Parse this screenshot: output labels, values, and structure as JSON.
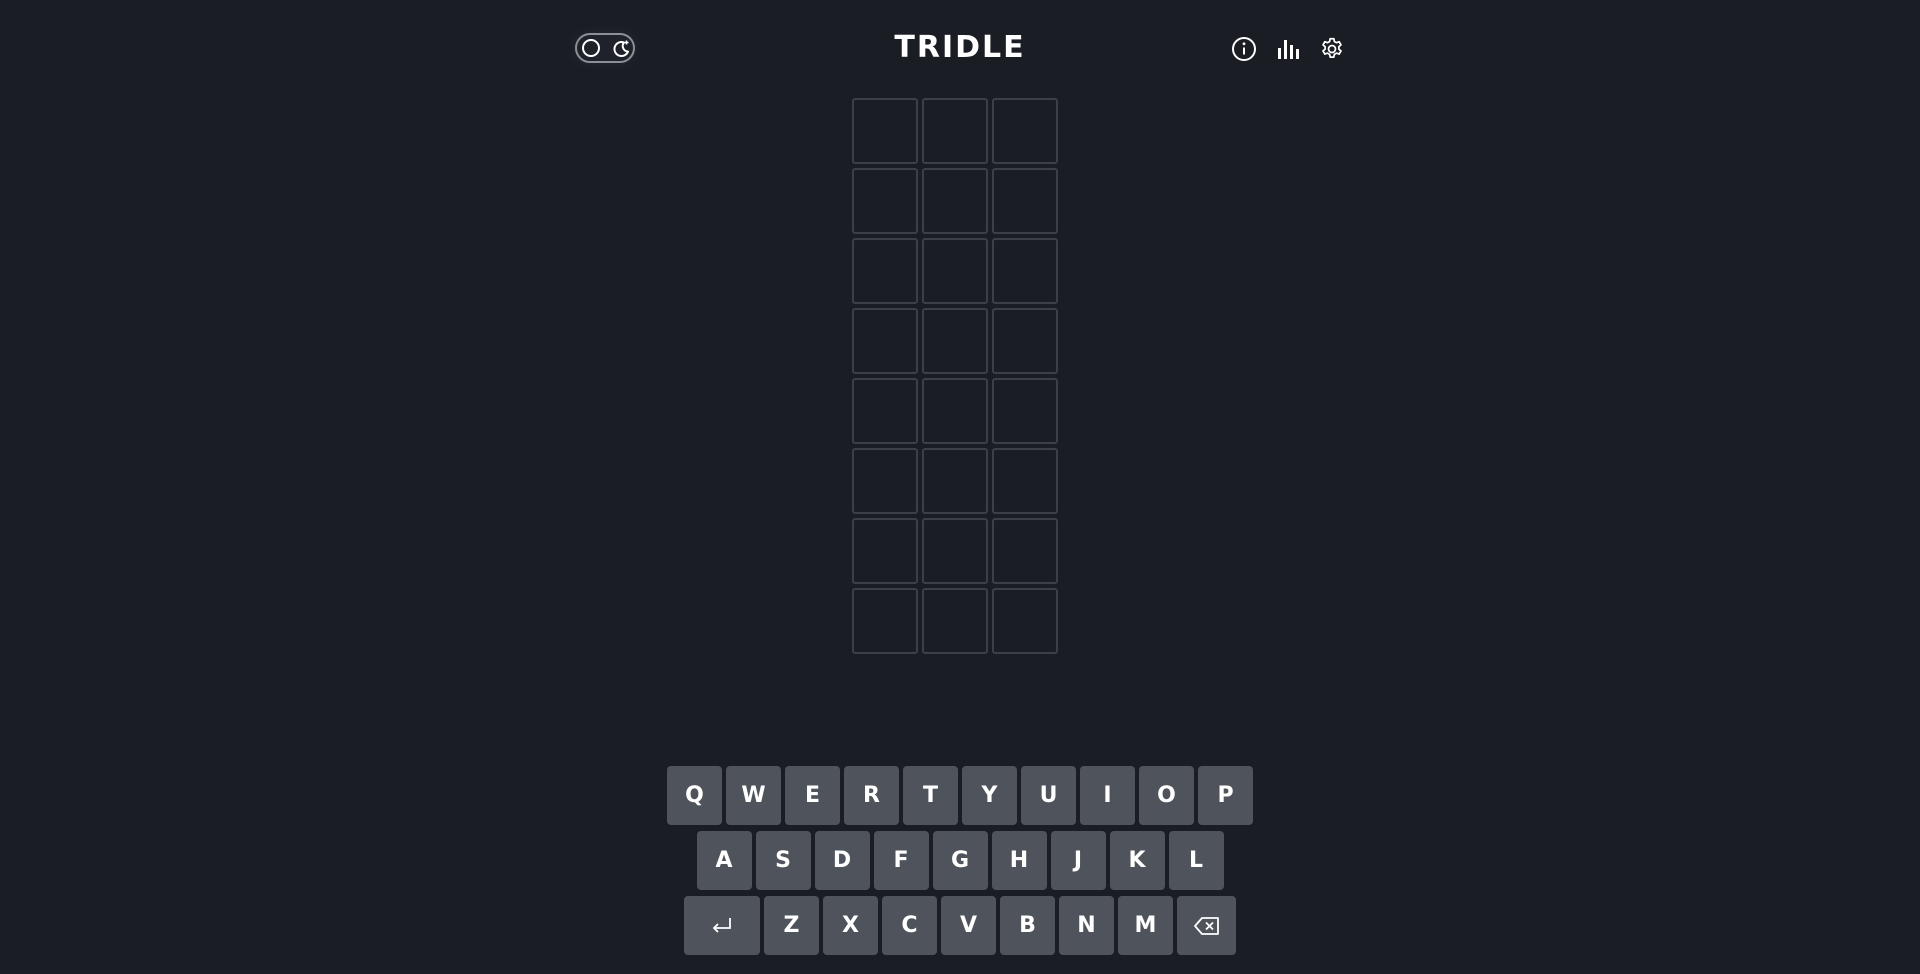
{
  "header": {
    "title": "TRIDLE",
    "icons": [
      "info-icon",
      "stats-icon",
      "settings-icon"
    ],
    "toggle_icons": [
      "sun-circle-icon",
      "moon-icon"
    ]
  },
  "board": {
    "rows": 8,
    "cols": 3,
    "cells": [
      [
        "",
        "",
        ""
      ],
      [
        "",
        "",
        ""
      ],
      [
        "",
        "",
        ""
      ],
      [
        "",
        "",
        ""
      ],
      [
        "",
        "",
        ""
      ],
      [
        "",
        "",
        ""
      ],
      [
        "",
        "",
        ""
      ],
      [
        "",
        "",
        ""
      ]
    ]
  },
  "keyboard": {
    "row1": [
      "Q",
      "W",
      "E",
      "R",
      "T",
      "Y",
      "U",
      "I",
      "O",
      "P"
    ],
    "row2": [
      "A",
      "S",
      "D",
      "F",
      "G",
      "H",
      "J",
      "K",
      "L"
    ],
    "row3": [
      "Z",
      "X",
      "C",
      "V",
      "B",
      "N",
      "M"
    ],
    "enter_icon": "enter-icon",
    "backspace_icon": "backspace-icon"
  },
  "colors": {
    "background": "#1a1d24",
    "key": "#4f545c",
    "cell_border": "#3b3f47",
    "text": "#ffffff"
  }
}
